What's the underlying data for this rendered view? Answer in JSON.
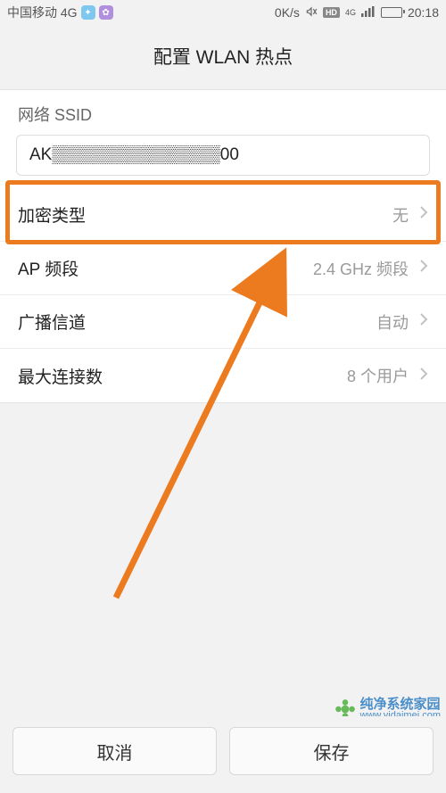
{
  "status": {
    "carrier": "中国移动 4G",
    "speed": "0K/s",
    "hd": "HD",
    "net": "4G",
    "time": "20:18"
  },
  "header": {
    "title": "配置 WLAN 热点"
  },
  "ssid": {
    "label": "网络 SSID",
    "value": "AK▒▒▒▒▒▒▒▒▒▒▒▒▒▒00"
  },
  "rows": {
    "encryption": {
      "label": "加密类型",
      "value": "无"
    },
    "band": {
      "label": "AP 频段",
      "value": "2.4 GHz 频段"
    },
    "channel": {
      "label": "广播信道",
      "value": "自动"
    },
    "maxconn": {
      "label": "最大连接数",
      "value": "8 个用户"
    }
  },
  "buttons": {
    "cancel": "取消",
    "save": "保存"
  },
  "watermark": {
    "brand": "纯净系统家园",
    "url": "www.yidaimei.com"
  }
}
